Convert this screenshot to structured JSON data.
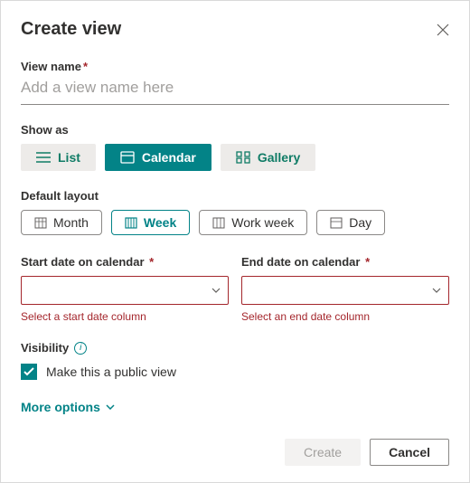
{
  "dialog": {
    "title": "Create view",
    "name_label": "View name",
    "name_placeholder": "Add a view name here",
    "name_value": "",
    "show_as_label": "Show as",
    "show_as": {
      "list": "List",
      "calendar": "Calendar",
      "gallery": "Gallery",
      "selected": "calendar"
    },
    "layout_label": "Default layout",
    "layout": {
      "month": "Month",
      "week": "Week",
      "workweek": "Work week",
      "day": "Day",
      "selected": "week"
    },
    "start_date_label": "Start date on calendar",
    "start_date_value": "",
    "start_date_error": "Select a start date column",
    "end_date_label": "End date on calendar",
    "end_date_value": "",
    "end_date_error": "Select an end date column",
    "visibility_label": "Visibility",
    "public_checked": true,
    "public_label": "Make this a public view",
    "more_options": "More options",
    "create_btn": "Create",
    "cancel_btn": "Cancel"
  },
  "colors": {
    "accent": "#038387",
    "error": "#a4262c"
  }
}
